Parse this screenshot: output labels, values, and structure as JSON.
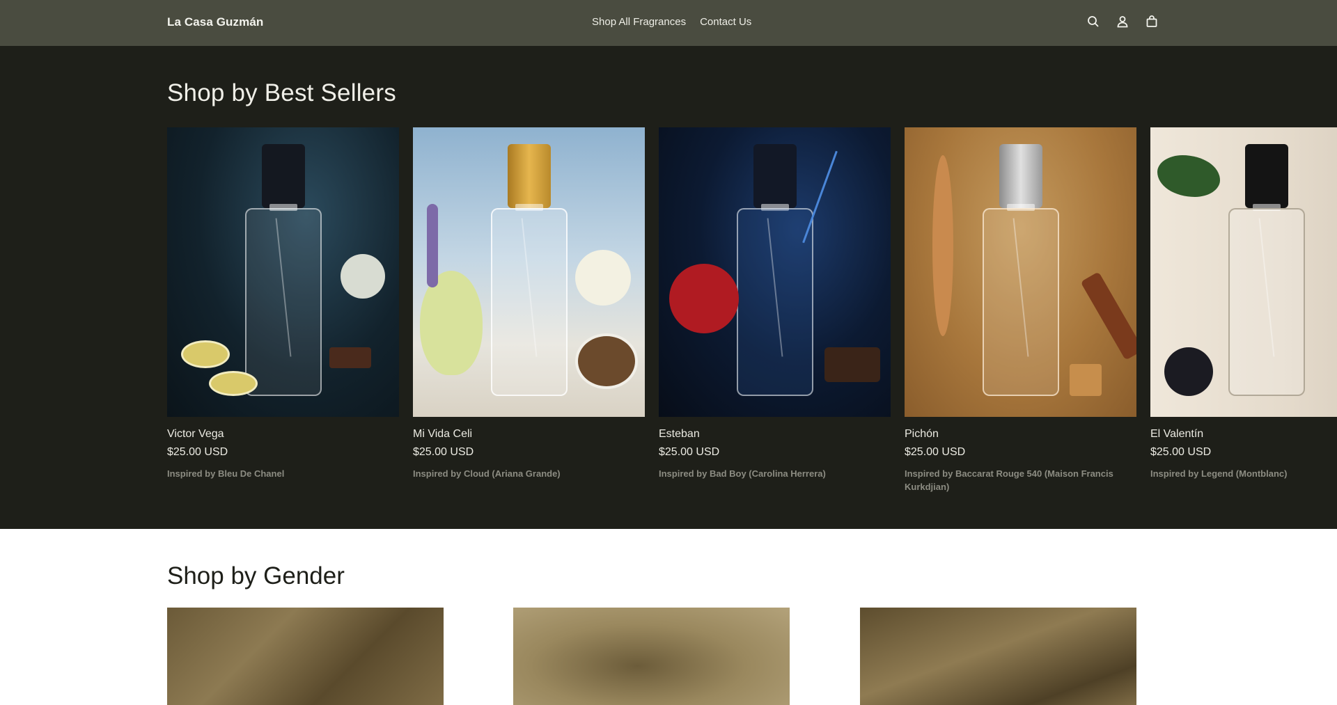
{
  "header": {
    "brand": "La Casa Guzmán",
    "nav": [
      "Shop All Fragrances",
      "Contact Us"
    ],
    "icons": [
      "search-icon",
      "account-icon",
      "cart-icon"
    ]
  },
  "bestsellers": {
    "title": "Shop by Best Sellers",
    "products": [
      {
        "name": "Victor Vega",
        "price": "$25.00 USD",
        "inspired": "Inspired by Bleu De Chanel"
      },
      {
        "name": "Mi Vida Celi",
        "price": "$25.00 USD",
        "inspired": "Inspired by Cloud (Ariana Grande)"
      },
      {
        "name": "Esteban",
        "price": "$25.00 USD",
        "inspired": "Inspired by Bad Boy (Carolina Herrera)"
      },
      {
        "name": "Pichón",
        "price": "$25.00 USD",
        "inspired": "Inspired by Baccarat Rouge 540 (Maison Francis Kurkdjian)"
      },
      {
        "name": "El Valentín",
        "price": "$25.00 USD",
        "inspired": "Inspired by Legend (Montblanc)"
      }
    ]
  },
  "gender": {
    "title": "Shop by Gender"
  },
  "colors": {
    "header_bg": "#4a4c40",
    "section_bg": "#1e1f19",
    "muted_text": "#8c8c82"
  }
}
